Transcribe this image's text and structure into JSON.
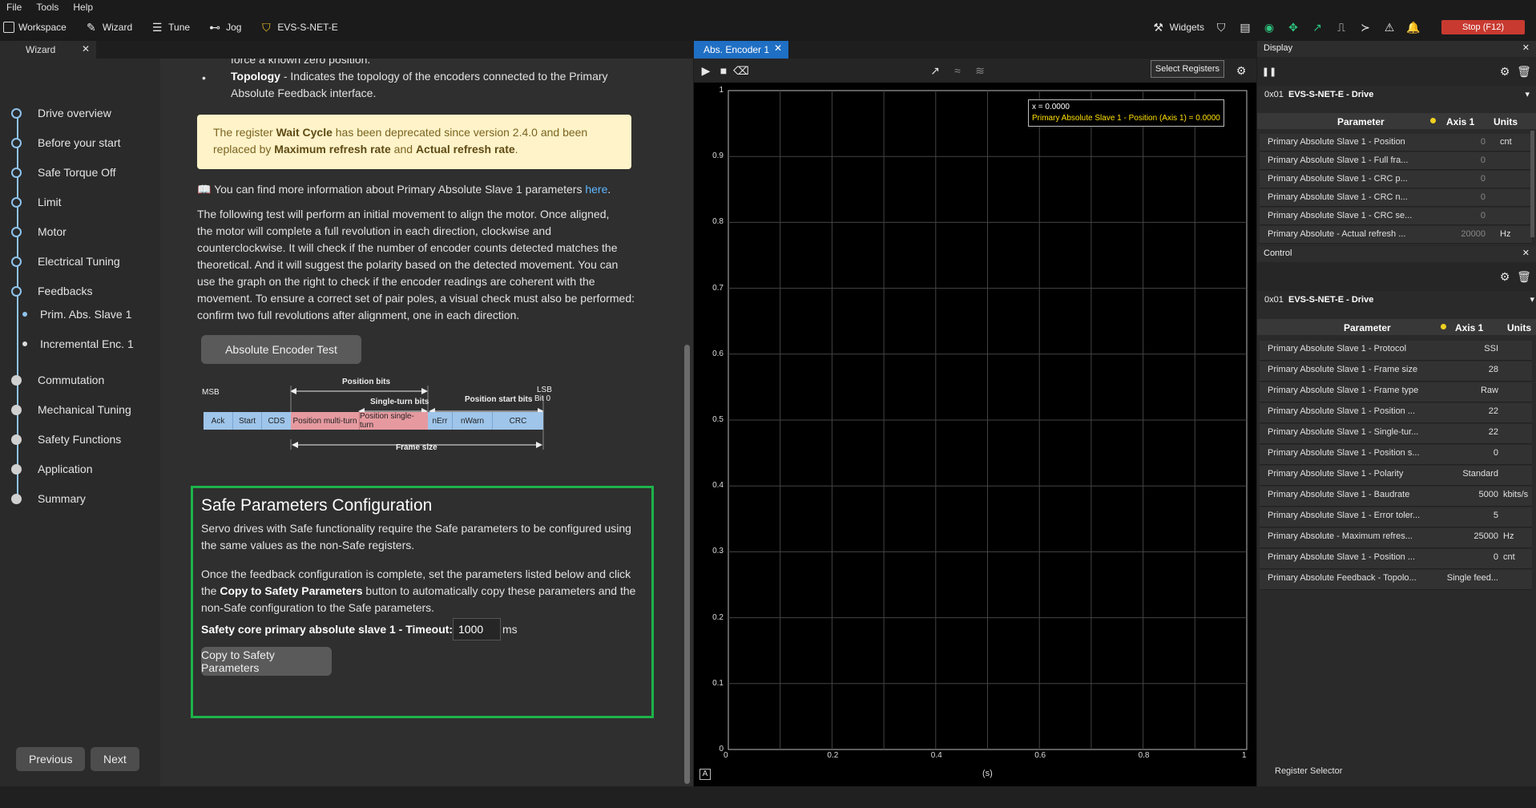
{
  "menu": [
    "File",
    "Tools",
    "Help"
  ],
  "toolbar": {
    "workspace": "Workspace",
    "wizard": "Wizard",
    "tune": "Tune",
    "jog": "Jog",
    "device": "EVS-S-NET-E",
    "widgets": "Widgets",
    "stop": "Stop (F12)"
  },
  "wizard": {
    "tab_label": "Wizard",
    "steps": [
      {
        "label": "Drive overview"
      },
      {
        "label": "Before your start"
      },
      {
        "label": "Safe Torque Off"
      },
      {
        "label": "Limit"
      },
      {
        "label": "Motor"
      },
      {
        "label": "Electrical Tuning"
      },
      {
        "label": "Feedbacks"
      },
      {
        "label": "Prim. Abs. Slave 1"
      },
      {
        "label": "Incremental Enc. 1"
      },
      {
        "label": "Commutation"
      },
      {
        "label": "Mechanical Tuning"
      },
      {
        "label": "Safety Functions"
      },
      {
        "label": "Application"
      },
      {
        "label": "Summary"
      }
    ],
    "previous": "Previous",
    "next": "Next"
  },
  "content": {
    "top_line": "force a known zero position.",
    "topology_bold": "Topology",
    "topology_text": " - Indicates the topology of the encoders connected to the Primary",
    "topology_text2": "Absolute Feedback interface.",
    "warn_1": "The register ",
    "warn_wait": "Wait Cycle",
    "warn_2": " has been deprecated since version 2.4.0 and been",
    "warn_3": "replaced by ",
    "warn_max": "Maximum refresh rate",
    "warn_and": " and ",
    "warn_actual": "Actual refresh rate",
    "warn_end": ".",
    "info_text": "📖 You can find more information about Primary Absolute Slave 1 parameters ",
    "info_link": "here",
    "info_end": ".",
    "para": [
      "The following test will perform an initial movement to align the motor. Once aligned,",
      "the motor will complete a full revolution in each direction, clockwise and",
      "counterclockwise. It will check if the number of encoder counts detected matches the",
      "theoretical. And it will suggest the polarity based on the detected movement. You can",
      "use the graph on the right to check if the encoder readings are coherent with the",
      "movement. To ensure a correct set of pair poles, a visual check must also be performed:",
      "confirm two full revolutions after alignment, one in each direction."
    ],
    "test_button": "Absolute Encoder Test",
    "frame": {
      "msb": "MSB",
      "lsb": "LSB",
      "bit0": "Bit 0",
      "position_bits": "Position bits",
      "single_turn_bits": "Single-turn bits",
      "position_start_bits": "Position start bits",
      "frame_size": "Frame size",
      "cells": [
        "Ack",
        "Start",
        "CDS",
        "Position multi-turn",
        "Position single-turn",
        "nErr",
        "nWarn",
        "CRC"
      ]
    },
    "safe": {
      "title": "Safe Parameters Configuration",
      "p1a": "Servo drives with Safe functionality require the Safe parameters to be configured using",
      "p1b": "the same values as the non-Safe registers.",
      "p2a": "Once the feedback configuration is complete, set the parameters listed below and click",
      "p2b_pre": "the ",
      "p2b_bold": "Copy to Safety Parameters",
      "p2b_post": " button to automatically copy these parameters and the",
      "p2c": "non-Safe configuration to the Safe parameters.",
      "timeout_label": "Safety core primary absolute slave 1 - Timeout:",
      "timeout_value": "1000",
      "timeout_unit": "ms",
      "copy_button": "Copy to Safety Parameters"
    }
  },
  "encoder": {
    "tab_label": "Abs. Encoder 1",
    "select_registers": "Select Registers",
    "y_ticks": [
      "1",
      "0.9",
      "0.8",
      "0.7",
      "0.6",
      "0.5",
      "0.4",
      "0.3",
      "0.2",
      "0.1",
      "0"
    ],
    "x_ticks": [
      "0",
      "0.2",
      "0.4",
      "0.6",
      "0.8",
      "1"
    ],
    "x_unit": "(s)",
    "auto_label": "A",
    "tooltip_x": "x = 0.0000",
    "tooltip_series": "Primary Absolute Slave 1 - Position (Axis 1) = 0.0000",
    "colors": {
      "series": "#ffe000",
      "grid": "#444444"
    }
  },
  "display": {
    "title": "Display",
    "drive_id": "0x01",
    "drive_name": "EVS-S-NET-E - Drive",
    "headers": {
      "param": "Parameter",
      "axis": "Axis 1",
      "units": "Units"
    },
    "rows": [
      {
        "p": "Primary Absolute Slave 1 - Position",
        "v": "0",
        "u": "cnt"
      },
      {
        "p": "Primary Absolute Slave 1 - Full fra...",
        "v": "0",
        "u": ""
      },
      {
        "p": "Primary Absolute Slave 1 - CRC p...",
        "v": "0",
        "u": ""
      },
      {
        "p": "Primary Absolute Slave 1 - CRC n...",
        "v": "0",
        "u": ""
      },
      {
        "p": "Primary Absolute Slave 1 - CRC se...",
        "v": "0",
        "u": ""
      },
      {
        "p": "Primary Absolute - Actual refresh ...",
        "v": "20000",
        "u": "Hz"
      }
    ]
  },
  "control": {
    "title": "Control",
    "drive_id": "0x01",
    "drive_name": "EVS-S-NET-E - Drive",
    "headers": {
      "param": "Parameter",
      "axis": "Axis 1",
      "units": "Units"
    },
    "rows": [
      {
        "p": "Primary Absolute Slave 1 - Protocol",
        "v": "SSI",
        "u": ""
      },
      {
        "p": "Primary Absolute Slave 1 - Frame size",
        "v": "28",
        "u": ""
      },
      {
        "p": "Primary Absolute Slave 1 - Frame type",
        "v": "Raw",
        "u": ""
      },
      {
        "p": "Primary Absolute Slave 1 - Position ...",
        "v": "22",
        "u": ""
      },
      {
        "p": "Primary Absolute Slave 1 - Single-tur...",
        "v": "22",
        "u": ""
      },
      {
        "p": "Primary Absolute Slave 1 - Position s...",
        "v": "0",
        "u": ""
      },
      {
        "p": "Primary Absolute Slave 1 - Polarity",
        "v": "Standard",
        "u": ""
      },
      {
        "p": "Primary Absolute Slave 1 - Baudrate",
        "v": "5000",
        "u": "kbits/s"
      },
      {
        "p": "Primary Absolute Slave 1 - Error toler...",
        "v": "5",
        "u": ""
      },
      {
        "p": "Primary Absolute - Maximum refres...",
        "v": "25000",
        "u": "Hz"
      },
      {
        "p": "Primary Absolute Slave 1 - Position ...",
        "v": "0",
        "u": "cnt"
      },
      {
        "p": "Primary Absolute Feedback - Topolo...",
        "v": "Single feed...",
        "u": ""
      }
    ],
    "register_selector": "Register Selector"
  }
}
